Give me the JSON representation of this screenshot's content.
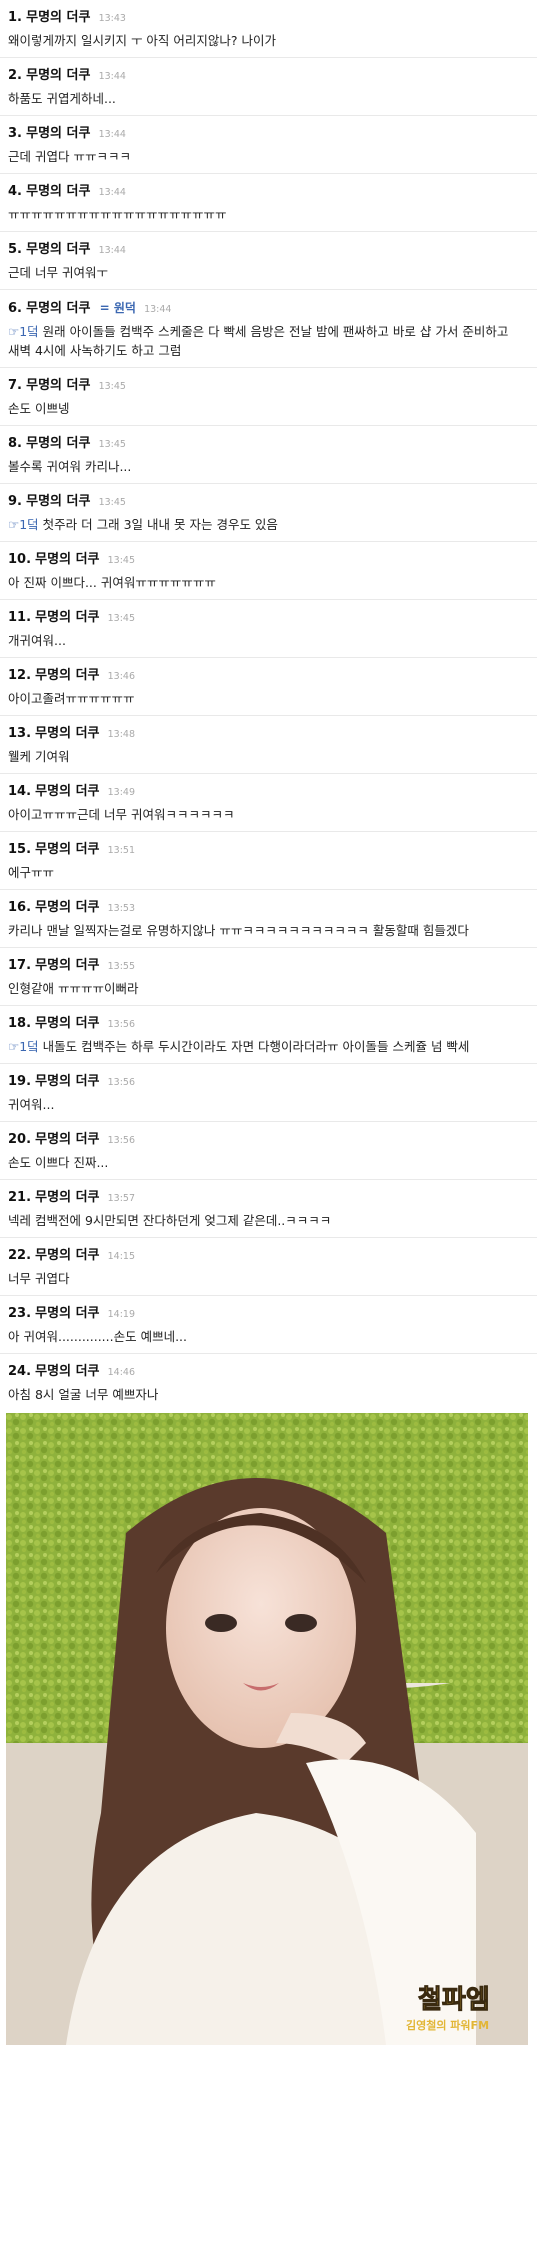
{
  "comments": [
    {
      "num": "1.",
      "author": "무명의 더쿠",
      "time": "13:43",
      "text": "왜이렇게까지 일시키지 ㅜ 아직 어리지않나? 나이가"
    },
    {
      "num": "2.",
      "author": "무명의 더쿠",
      "time": "13:44",
      "text": "하품도 귀엽게하네..."
    },
    {
      "num": "3.",
      "author": "무명의 더쿠",
      "time": "13:44",
      "text": "근데 귀엽다 ㅠㅠㅋㅋㅋ"
    },
    {
      "num": "4.",
      "author": "무명의 더쿠",
      "time": "13:44",
      "text": "ㅠㅠㅠㅠㅠㅠㅠㅠㅠㅠㅠㅠㅠㅠㅠㅠㅠㅠㅠ"
    },
    {
      "num": "5.",
      "author": "무명의 더쿠",
      "time": "13:44",
      "text": "근데 너무 귀여워ㅜ"
    },
    {
      "num": "6.",
      "author": "무명의 더쿠",
      "badge": "= 원덕",
      "time": "13:44",
      "reply": "☞1덬",
      "text": "원래 아이돌들 컴백주 스케줄은 다 빡세 음방은 전날 밤에 팬싸하고 바로 샵 가서 준비하고 새벽 4시에 사녹하기도 하고 그럼"
    },
    {
      "num": "7.",
      "author": "무명의 더쿠",
      "time": "13:45",
      "text": "손도 이쁘넹"
    },
    {
      "num": "8.",
      "author": "무명의 더쿠",
      "time": "13:45",
      "text": "볼수록 귀여워 카리나..."
    },
    {
      "num": "9.",
      "author": "무명의 더쿠",
      "time": "13:45",
      "reply": "☞1덬",
      "text": "첫주라 더 그래 3일 내내 못 자는 경우도 있음"
    },
    {
      "num": "10.",
      "author": "무명의 더쿠",
      "time": "13:45",
      "text": "아 진짜 이쁘다... 귀여워ㅠㅠㅠㅠㅠㅠㅠ"
    },
    {
      "num": "11.",
      "author": "무명의 더쿠",
      "time": "13:45",
      "text": "개귀여워..."
    },
    {
      "num": "12.",
      "author": "무명의 더쿠",
      "time": "13:46",
      "text": "아이고졸려ㅠㅠㅠㅠㅠㅠ"
    },
    {
      "num": "13.",
      "author": "무명의 더쿠",
      "time": "13:48",
      "text": "웰케 기여워"
    },
    {
      "num": "14.",
      "author": "무명의 더쿠",
      "time": "13:49",
      "text": "아이고ㅠㅠㅠ근데 너무 귀여워ㅋㅋㅋㅋㅋㅋ"
    },
    {
      "num": "15.",
      "author": "무명의 더쿠",
      "time": "13:51",
      "text": "에구ㅠㅠ"
    },
    {
      "num": "16.",
      "author": "무명의 더쿠",
      "time": "13:53",
      "text": "카리나 맨날 일찍자는걸로 유명하지않나 ㅠㅠㅋㅋㅋㅋㅋㅋㅋㅋㅋㅋㅋ 활동할때 힘들겠다"
    },
    {
      "num": "17.",
      "author": "무명의 더쿠",
      "time": "13:55",
      "text": "인형같애 ㅠㅠㅠㅠ이뻐라"
    },
    {
      "num": "18.",
      "author": "무명의 더쿠",
      "time": "13:56",
      "reply": "☞1덬",
      "text": "내돌도 컴백주는 하루 두시간이라도 자면 다행이라더라ㅠ 아이돌들 스케쥴 넘 빡세"
    },
    {
      "num": "19.",
      "author": "무명의 더쿠",
      "time": "13:56",
      "text": "귀여워..."
    },
    {
      "num": "20.",
      "author": "무명의 더쿠",
      "time": "13:56",
      "text": "손도 이쁘다 진짜..."
    },
    {
      "num": "21.",
      "author": "무명의 더쿠",
      "time": "13:57",
      "text": "넥레 컴백전에 9시만되면 잔다하던게 엊그제 같은데..ㅋㅋㅋㅋ"
    },
    {
      "num": "22.",
      "author": "무명의 더쿠",
      "time": "14:15",
      "text": "너무 귀엽다"
    },
    {
      "num": "23.",
      "author": "무명의 더쿠",
      "time": "14:19",
      "text": "아 귀여워..............손도 예쁘네..."
    },
    {
      "num": "24.",
      "author": "무명의 더쿠",
      "time": "14:46",
      "text": "아침 8시 얼굴 너무 예쁘자나"
    }
  ],
  "photo": {
    "watermark_line1": "철파엠",
    "watermark_line2": "김영철의 파워FM"
  },
  "colors": {
    "time": "#aaaaaa",
    "reply": "#3b67b1",
    "divider": "#e9e9e9",
    "moss": "#8fb23c"
  }
}
